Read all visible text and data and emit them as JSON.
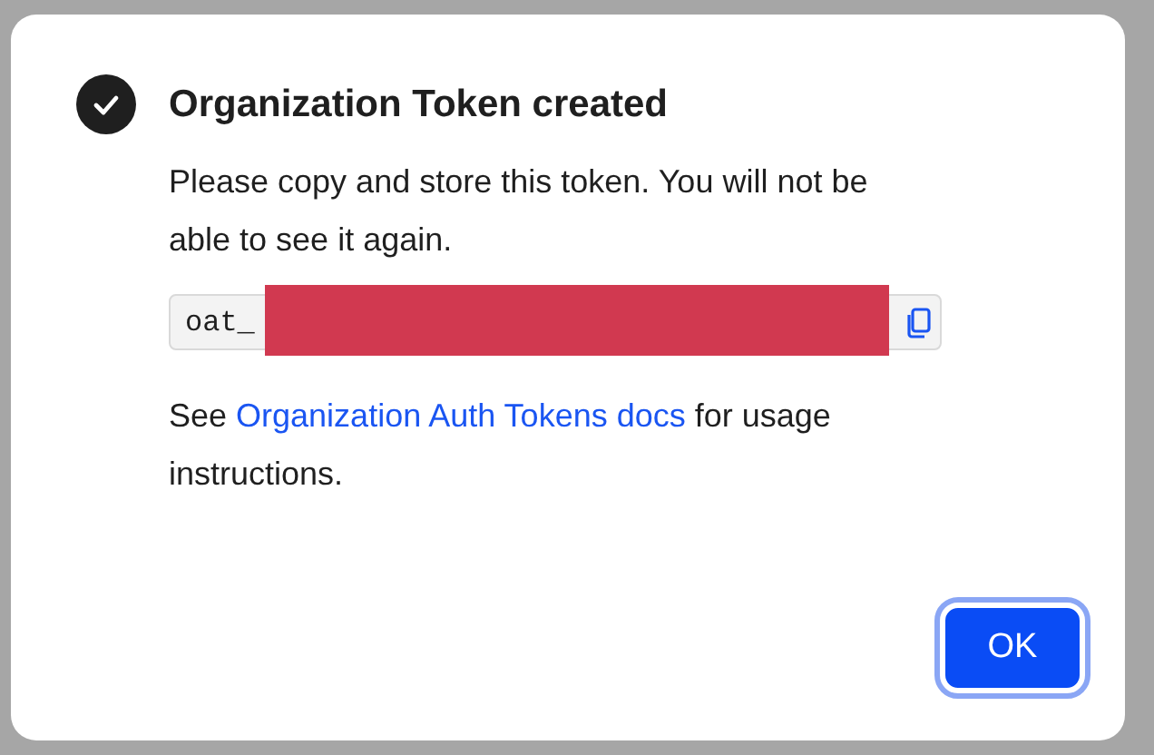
{
  "dialog": {
    "title": "Organization Token created",
    "success": true,
    "message": "Please copy and store this token. You will not be able to see it again.",
    "token": {
      "value": "oat_",
      "redacted": true
    },
    "help": {
      "before": "See ",
      "link": "Organization Auth Tokens docs",
      "after": " for usage instructions."
    },
    "buttons": [
      {
        "label": "OK",
        "focused": true
      }
    ]
  }
}
